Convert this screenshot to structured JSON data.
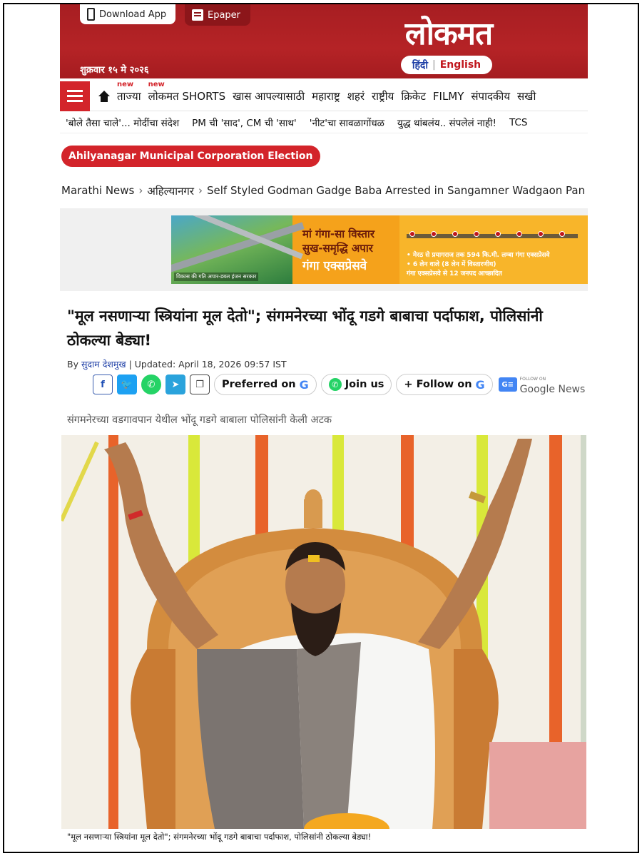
{
  "header": {
    "download_app": "Download App",
    "epaper": "Epaper",
    "logo": "लोकमत",
    "lang_hindi": "हिंदी",
    "lang_sep": "|",
    "lang_english": "English",
    "date": "शुक्रवार १५ मे २०२६"
  },
  "nav": {
    "items": [
      {
        "label": "ताज्या",
        "tag": "new"
      },
      {
        "label": "लोकमत SHORTS",
        "tag": "new"
      },
      {
        "label": "खास आपल्यासाठी",
        "tag": ""
      },
      {
        "label": "महाराष्ट्र",
        "tag": ""
      },
      {
        "label": "शहरं",
        "tag": ""
      },
      {
        "label": "राष्ट्रीय",
        "tag": ""
      },
      {
        "label": "क्रिकेट",
        "tag": ""
      },
      {
        "label": "FILMY",
        "tag": ""
      },
      {
        "label": "संपादकीय",
        "tag": ""
      },
      {
        "label": "सखी",
        "tag": ""
      }
    ]
  },
  "trending": [
    "'बोले तैसा चाले'... मोदींचा संदेश",
    "PM ची 'साद', CM ची 'साथ'",
    "'नीट'चा सावळागोंधळ",
    "युद्ध थांबलंय.. संपलेलं नाही!",
    "TCS"
  ],
  "topic_tag": "Ahilyanagar Municipal Corporation Election",
  "breadcrumb": [
    "Marathi News",
    "अहिल्यानगर",
    "Self Styled Godman Gadge Baba Arrested in Sangamner Wadgaon Pan"
  ],
  "ad": {
    "left_caption": "विकास की गति अपार-डबल इंजन सरकार",
    "line1": "मां गंगा-सा विस्तार",
    "line2": "सुख-समृद्धि अपार",
    "line3": "गंगा एक्सप्रेसवे",
    "bullet1": "• मेरठ से प्रयागराज तक 594 कि.मी. लम्बा गंगा एक्सप्रेसवे",
    "bullet2": "• 6 लेन वाले (8 लेन में विस्तारणीय)",
    "bullet3": "गंगा एक्सप्रेसवे से 12 जनपद आच्छादित"
  },
  "article": {
    "headline": "\"मूल नसणाऱ्या स्त्रियांना मूल देतो\"; संगमनेरच्या भोंदू गडगे बाबाचा पर्दाफाश, पोलिसांनी ठोकल्या बेड्या!",
    "by_label": "By",
    "author": "सुदाम देशमुख",
    "updated": "| Updated: April 18, 2026 09:57 IST",
    "subhead": "संगमनेरच्या वडगावपान येथील भोंदू गडगे बाबाला पोलिसांनी केली अटक",
    "caption": "\"मूल नसणाऱ्या स्त्रियांना मूल देतो\"; संगमनेरच्या भोंदू गडगे बाबाचा पर्दाफाश, पोलिसांनी ठोकल्या बेड्या!"
  },
  "share": {
    "preferred": "Preferred on",
    "join": "Join us",
    "follow": "+ Follow on",
    "gnews_follow": "FOLLOW ON",
    "gnews": "Google News"
  },
  "colors": {
    "brand_red": "#b52326",
    "accent_red": "#d3242a",
    "link_blue": "#1e3fa6"
  }
}
